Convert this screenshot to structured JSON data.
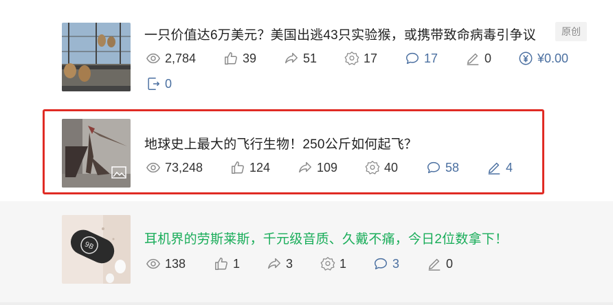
{
  "articles": [
    {
      "title": "一只价值达6万美元？美国出逃43只实验猴，或携带致命病毒引争议",
      "tag": "原创",
      "views": "2,784",
      "likes": "39",
      "shares": "51",
      "favorites": "17",
      "comments": "17",
      "edits": "0",
      "earnings": "¥0.00",
      "exports": "0",
      "thumb_icon": "monkeys-photo"
    },
    {
      "title": "地球史上最大的飞行生物！250公斤如何起飞？",
      "views": "73,248",
      "likes": "124",
      "shares": "109",
      "favorites": "40",
      "comments": "58",
      "edits": "4",
      "thumb_icon": "pterosaur-photo",
      "overlay_icon": "image-gallery-icon"
    },
    {
      "title": "耳机界的劳斯莱斯，千元级音质、久戴不痛，今日2位数拿下！",
      "views": "138",
      "likes": "1",
      "shares": "3",
      "favorites": "1",
      "comments": "3",
      "edits": "0",
      "thumb_icon": "earphone-case-photo"
    }
  ],
  "colors": {
    "highlight_border": "#e02b24",
    "green_title": "#1aad5a",
    "comment_blue": "#4a6fa0",
    "icon_gray": "#8a8a8a"
  }
}
